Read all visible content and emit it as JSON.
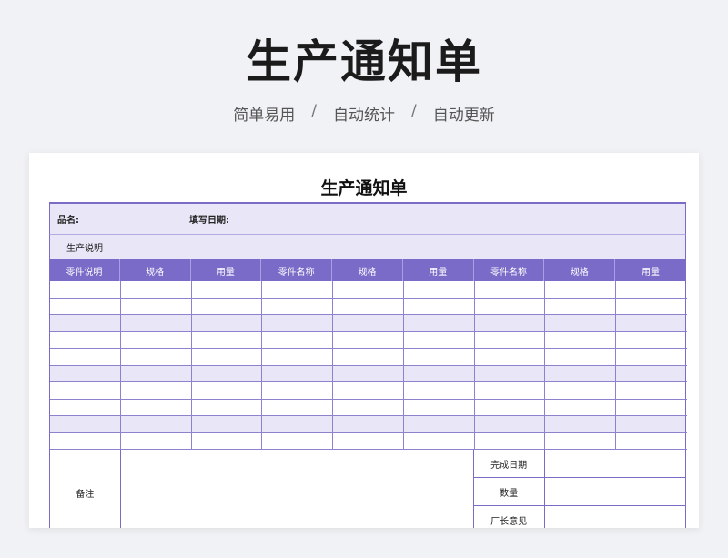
{
  "hero": {
    "title": "生产通知单",
    "tags": [
      "简单易用",
      "自动统计",
      "自动更新"
    ],
    "separator": "/"
  },
  "sheet": {
    "title": "生产通知单",
    "product_label": "品名:",
    "date_label": "填写日期:",
    "description_label": "生产说明",
    "columns": [
      "零件说明",
      "规格",
      "用量",
      "零件名称",
      "规格",
      "用量",
      "零件名称",
      "规格",
      "用量"
    ],
    "footer": {
      "remarks_label": "备注",
      "side_labels": [
        "完成日期",
        "数量",
        "厂长意见"
      ]
    }
  },
  "colors": {
    "accent": "#7b6bc9",
    "shade": "#e9e6f7",
    "background": "#f1f2f5"
  }
}
